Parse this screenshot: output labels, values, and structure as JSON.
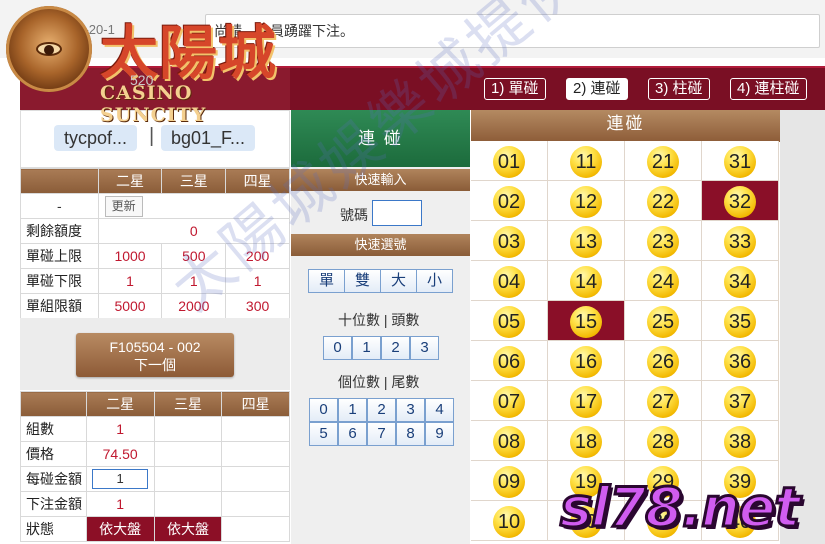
{
  "marquee": {
    "date_text": "23-20-1",
    "text": "尚請…會員踴躍下注。"
  },
  "logo": {
    "cn": "太陽城",
    "en": "CASINO SUNCITY",
    "num": "520"
  },
  "modes": [
    "1) 單碰",
    "2) 連碰",
    "3) 柱碰",
    "4) 連柱碰"
  ],
  "active_mode_index": 1,
  "user": {
    "account": "tycpof...",
    "separator": "|",
    "sub": "bg01_F..."
  },
  "limits": {
    "headers": [
      "",
      "二星",
      "三星",
      "四星"
    ],
    "dash": "-",
    "refresh_label": "更新",
    "rows": [
      {
        "label": "剩餘額度",
        "values": [
          "0"
        ]
      },
      {
        "label": "單碰上限",
        "values": [
          "1000",
          "500",
          "200"
        ]
      },
      {
        "label": "單碰下限",
        "values": [
          "1",
          "1",
          "1"
        ]
      },
      {
        "label": "單組限額",
        "values": [
          "5000",
          "2000",
          "300"
        ]
      }
    ]
  },
  "next": {
    "line1": "F105504 - 002",
    "line2": "下一個"
  },
  "bet": {
    "headers": [
      "",
      "二星",
      "三星",
      "四星"
    ],
    "rows": [
      {
        "label": "組數",
        "value": "1"
      },
      {
        "label": "價格",
        "value": "74.50"
      },
      {
        "label": "每碰金額",
        "value": "1"
      },
      {
        "label": "下注金額",
        "value": "1"
      },
      {
        "label": "狀態",
        "value": "依大盤",
        "value2": "依大盤"
      }
    ]
  },
  "middle": {
    "title": "連 碰",
    "quick_input": "快速輸入",
    "number_label": "號碼",
    "quick_select": "快速選號",
    "quick_btns": [
      "單",
      "雙",
      "大",
      "小"
    ],
    "tens_label": "十位數",
    "tens_sep": "|",
    "head_label": "頭數",
    "tens_digits": [
      "0",
      "1",
      "2",
      "3"
    ],
    "units_label": "個位數",
    "units_sep": "|",
    "tail_label": "尾數",
    "units_digits": [
      "0",
      "1",
      "2",
      "3",
      "4",
      "5",
      "6",
      "7",
      "8",
      "9"
    ]
  },
  "numbers": {
    "title": "連碰",
    "values": [
      "01",
      "11",
      "21",
      "31",
      "02",
      "12",
      "22",
      "32",
      "03",
      "13",
      "23",
      "33",
      "04",
      "14",
      "24",
      "34",
      "05",
      "15",
      "25",
      "35",
      "06",
      "16",
      "26",
      "36",
      "07",
      "17",
      "27",
      "37",
      "08",
      "18",
      "28",
      "38",
      "09",
      "19",
      "29",
      "39",
      "10",
      "20",
      "30",
      "40"
    ],
    "selected": [
      "15",
      "32"
    ]
  },
  "watermark": "太陽城娛樂城提供",
  "site": "sl78.net"
}
